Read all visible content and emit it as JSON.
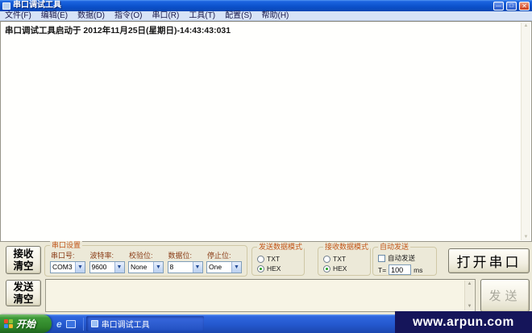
{
  "window": {
    "title": "串口调试工具",
    "controls": {
      "minimize": "—",
      "maximize": "□",
      "close": "✕"
    }
  },
  "menu_bar": {
    "items": [
      "文件(F)",
      "编辑(E)",
      "数据(D)",
      "指令(O)",
      "串口(R)",
      "工具(T)",
      "配置(S)",
      "帮助(H)"
    ]
  },
  "receive_area": {
    "log_text": "串口调试工具启动于 2012年11月25日(星期日)-14:43:43:031"
  },
  "serial_settings": {
    "title": "串口设置",
    "fields": [
      {
        "label": "串口号:",
        "value": "COM3"
      },
      {
        "label": "波特率:",
        "value": "9600"
      },
      {
        "label": "校验位:",
        "value": "None"
      },
      {
        "label": "数据位:",
        "value": "8"
      },
      {
        "label": "停止位:",
        "value": "One"
      }
    ]
  },
  "send_mode": {
    "title": "发送数据模式",
    "options": [
      "TXT",
      "HEX"
    ],
    "selected": "HEX"
  },
  "receive_mode": {
    "title": "接收数据模式",
    "options": [
      "TXT",
      "HEX"
    ],
    "selected": "HEX"
  },
  "auto_send": {
    "title": "自动发送",
    "checkbox_label": "自动发送",
    "checked": false,
    "interval_prefix": "T=",
    "interval_value": "100",
    "interval_unit": "ms"
  },
  "buttons": {
    "receive_clear": "接收\n清空",
    "send_clear": "发送\n清空",
    "open_port": "打开串口",
    "send": "发送",
    "send_enabled": false
  },
  "send_area": {
    "value": ""
  },
  "taskbar": {
    "start_label": "开始",
    "task_button_label": "串口调试工具"
  },
  "watermark": {
    "text": "www.arpun.com"
  },
  "colors": {
    "titlebar_blue": "#0c52cc",
    "menu_bg": "#d7e3f7",
    "panel_bg": "#ece9d8",
    "group_title_orange": "#c2571b",
    "field_label_brown": "#8a3c16",
    "taskbar_blue": "#2458ce",
    "start_green": "#2e8428",
    "watermark_bg": "#15155a",
    "radio_dot_green": "#21a121"
  }
}
